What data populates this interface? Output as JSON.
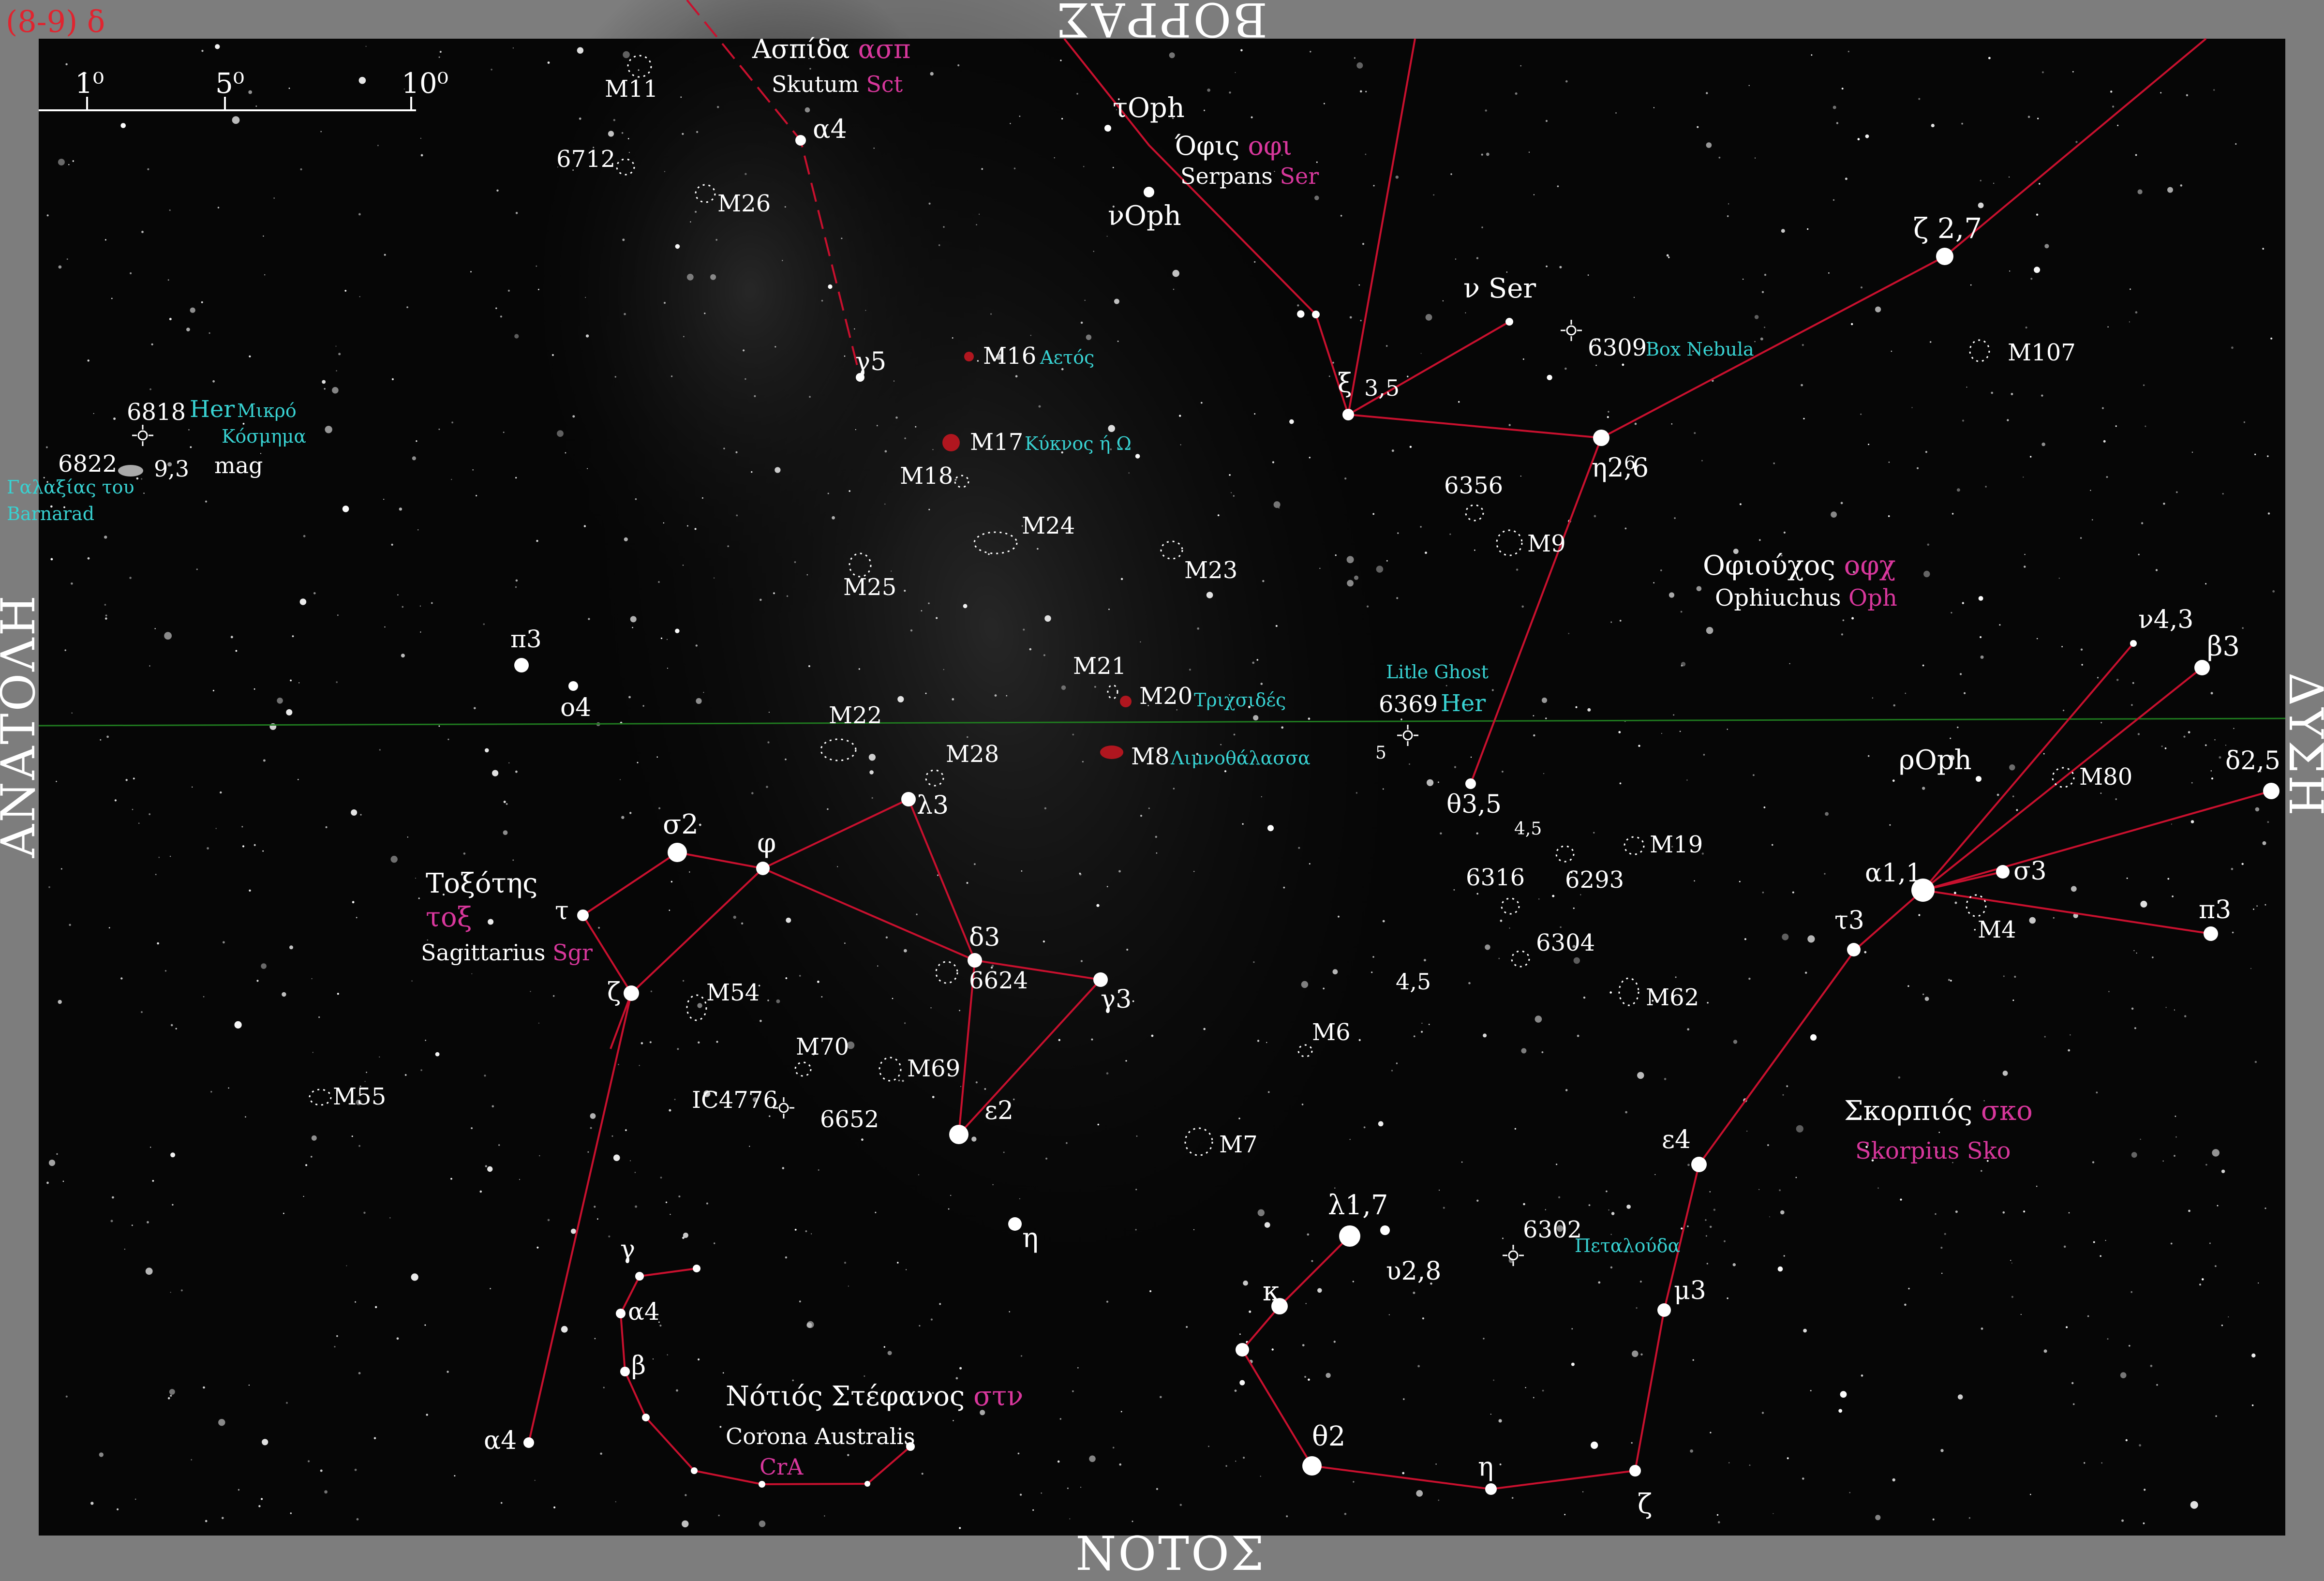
{
  "page_code": "(8-9) δ",
  "directions": {
    "north": "ΒΟΡΡΑΣ",
    "south": "ΝΟΤΟΣ",
    "east": "ΑΝΑΤΟΛΗ",
    "west": "ΔΥΣΗ"
  },
  "scale_bar": {
    "ticks": [
      "1⁰",
      "5⁰",
      "10⁰"
    ]
  },
  "constellations": {
    "scutum": {
      "name_gr": "Ασπίδα",
      "abbr_gr": "ασπ",
      "name_lat": "Skutum",
      "abbr_lat": "Sct"
    },
    "serpens": {
      "name_gr": "Όφις",
      "abbr_gr": "οφι",
      "name_lat": "Serpans",
      "abbr_lat": "Ser"
    },
    "ophiuchus": {
      "name_gr": "Οφιούχος",
      "abbr_gr": "οφχ",
      "name_lat": "Ophiuchus",
      "abbr_lat": "Oph"
    },
    "sagittarius": {
      "name_gr": "Τοξότης",
      "abbr_gr": "τοξ",
      "name_lat": "Sagittarius",
      "abbr_lat": "Sgr"
    },
    "scorpius": {
      "name_gr": "Σκορπιός",
      "abbr_gr": "σκο",
      "name_lat": "Skorpius",
      "abbr_lat": "Sko"
    },
    "corona_australis": {
      "name_gr": "Νότιός Στέφανος",
      "abbr_gr": "στν",
      "name_lat": "Corona Australis",
      "abbr_lat": "CrA"
    }
  },
  "deep_sky_nicknames": {
    "m16": "Αετός",
    "m17": "Κύκνος ή Ω",
    "m20": "Τριχσιδές",
    "m8": "Λιμνοθάλασσα",
    "ngc6309": "Box Nebula",
    "ngc6302": "Πεταλούδα",
    "ngc6369": "Litle Ghost",
    "ngc6818_a": "Μικρό",
    "ngc6818_b": "Κόσμημα",
    "ngc6822_a": "Γαλαξίας του",
    "ngc6822_b": "Barnarad"
  },
  "labels": {
    "her": "Her",
    "mag_value": "9,3",
    "mag_unit": "mag"
  },
  "star_labels": [
    "α4",
    "γ5",
    "τOph",
    "νOph",
    "ν Ser",
    "ξ",
    "3,5",
    "ζ 2,7",
    "η2,6",
    "6",
    "ν4,3",
    "β3",
    "δ2,5",
    "ρOph",
    "α1,1",
    "σ3",
    "π3",
    "τ3",
    "θ3,5",
    "5",
    "4,5",
    "4,5",
    "ε4",
    "μ3",
    "λ1,7",
    "υ2,8",
    "κ",
    "θ2",
    "η",
    "ζ",
    "π3",
    "ο4",
    "σ2",
    "φ",
    "λ3",
    "τ",
    "ζ",
    "δ3",
    "γ3",
    "ε2",
    "η",
    "γ",
    "α4",
    "β",
    "α4"
  ],
  "dso_labels": [
    "M11",
    "6712",
    "M26",
    "M16",
    "M17",
    "M18",
    "M24",
    "M25",
    "M23",
    "M21",
    "M20",
    "M8",
    "M22",
    "M28",
    "6624",
    "M54",
    "M70",
    "M69",
    "IC4776",
    "6652",
    "M55",
    "M6",
    "M7",
    "6818",
    "6822",
    "6309",
    "M107",
    "6356",
    "M9",
    "6369",
    "M80",
    "M4",
    "M19",
    "6316",
    "6293",
    "6304",
    "M62",
    "6302"
  ],
  "colors": {
    "sky": "#060606",
    "frame": "#7d7d7d",
    "line": "#c8102e",
    "magenta": "#d8379c",
    "cyan": "#38d2d2",
    "red": "#e0242f",
    "equator": "#1f7a1f"
  }
}
